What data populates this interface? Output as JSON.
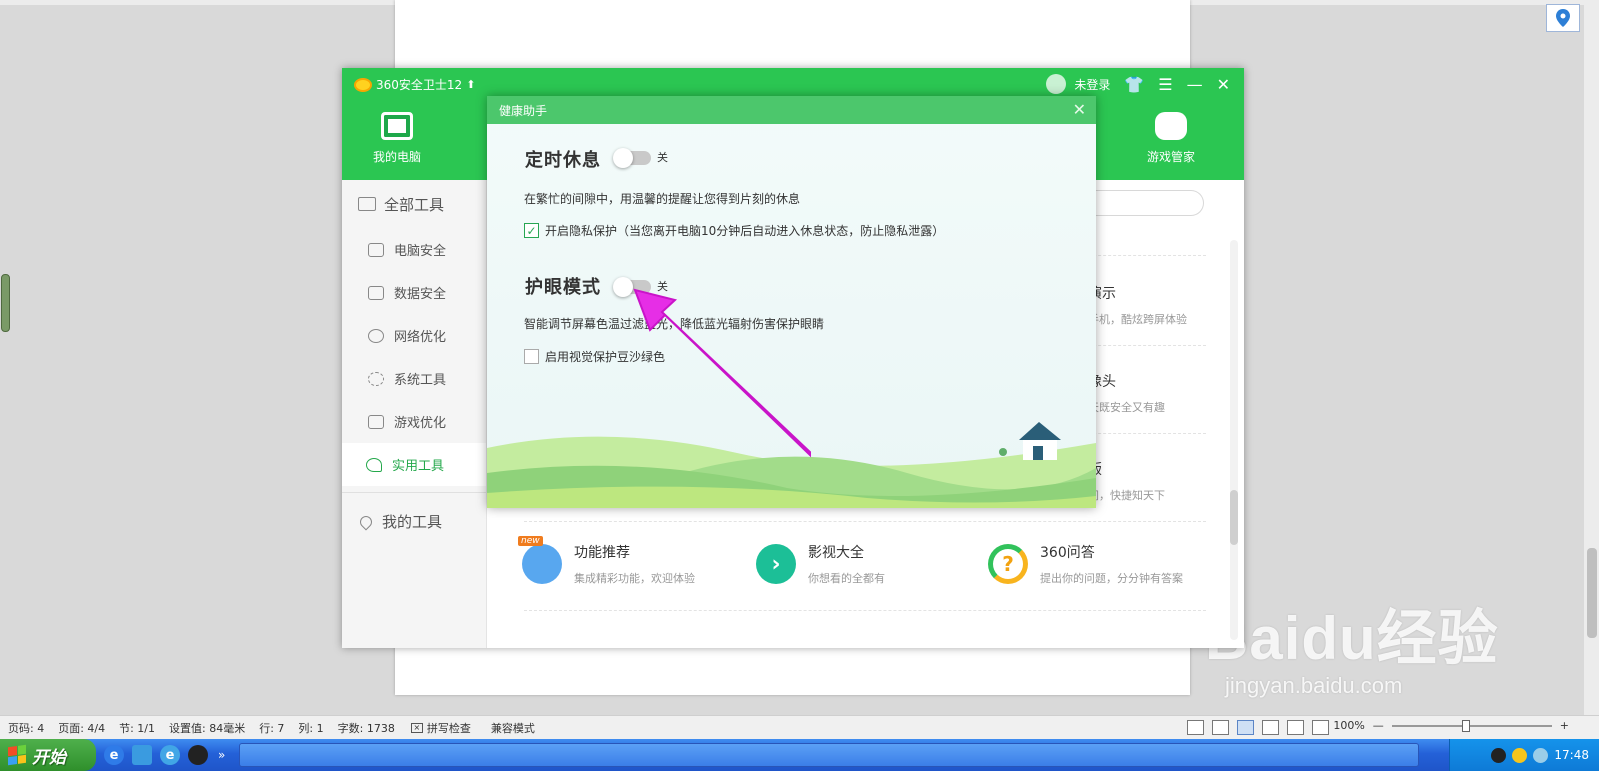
{
  "status_bar": {
    "page_code": "页码: 4",
    "pages": "页面: 4/4",
    "section": "节: 1/1",
    "setting": "设置值: 84毫米",
    "row": "行: 7",
    "col": "列: 1",
    "word_count": "字数: 1738",
    "spell_check": "拼写检查",
    "compat_mode": "兼容模式",
    "zoom": "100%"
  },
  "taskbar": {
    "start_label": "开始",
    "clock": "17:48"
  },
  "watermark": {
    "logo": "Baidu经验",
    "url": "jingyan.baidu.com"
  },
  "app": {
    "title": "360安全卫士12",
    "login_label": "未登录",
    "nav": {
      "my_pc": "我的电脑",
      "game_manager": "游戏管家"
    },
    "sidebar": {
      "all_tools": "全部工具",
      "items": [
        {
          "label": "电脑安全"
        },
        {
          "label": "数据安全"
        },
        {
          "label": "网络优化"
        },
        {
          "label": "系统工具"
        },
        {
          "label": "游戏优化"
        },
        {
          "label": "实用工具"
        }
      ],
      "my_tools": "我的工具"
    },
    "partial_tools": [
      {
        "name": "演示",
        "desc": "手机，酷炫跨屏体验"
      },
      {
        "name": "像头",
        "desc": "天既安全又有趣"
      },
      {
        "name": "版",
        "desc": "间，快捷知天下"
      }
    ],
    "tools": [
      {
        "name": "功能推荐",
        "desc": "集成精彩功能，欢迎体验",
        "badge": "new"
      },
      {
        "name": "影视大全",
        "desc": "你想看的全都有"
      },
      {
        "name": "360问答",
        "desc": "提出你的问题，分分钟有答案"
      }
    ]
  },
  "health_dialog": {
    "title": "健康助手",
    "rest": {
      "title": "定时休息",
      "toggle_state": "关",
      "desc": "在繁忙的间隙中，用温馨的提醒让您得到片刻的休息",
      "privacy_checkbox": "开启隐私保护（当您离开电脑10分钟后自动进入休息状态，防止隐私泄露）",
      "privacy_checked": true
    },
    "eye": {
      "title": "护眼模式",
      "toggle_state": "关",
      "desc": "智能调节屏幕色温过滤蓝光，降低蓝光辐射伤害保护眼睛",
      "green_checkbox": "启用视觉保护豆沙绿色",
      "green_checked": false
    }
  },
  "colors": {
    "brand_green": "#2bc652",
    "annotation_arrow": "#e62ee6"
  }
}
